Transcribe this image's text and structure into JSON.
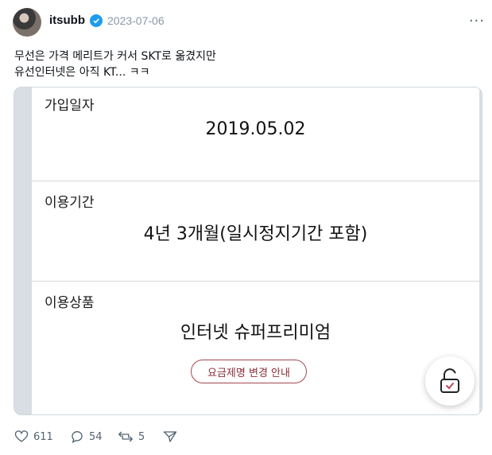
{
  "post": {
    "username": "itsubb",
    "date": "2023-07-06",
    "more_label": "···",
    "lines": [
      "무선은 가격 메리트가 커서 SKT로 옮겼지만",
      "유선인터넷은 아직 KT... ㅋㅋ"
    ]
  },
  "image": {
    "sections": [
      {
        "label": "가입일자",
        "value": "2019.05.02"
      },
      {
        "label": "이용기간",
        "value": "4년 3개월(일시정지기간 포함)"
      },
      {
        "label": "이용상품",
        "value": "인터넷 슈퍼프리미엄"
      }
    ],
    "pill_label": "요금제명 변경 안내"
  },
  "actions": {
    "likes": "611",
    "replies": "54",
    "reposts": "5"
  },
  "colors": {
    "accent": "#1d9bf0",
    "pill": "#a5474f"
  }
}
